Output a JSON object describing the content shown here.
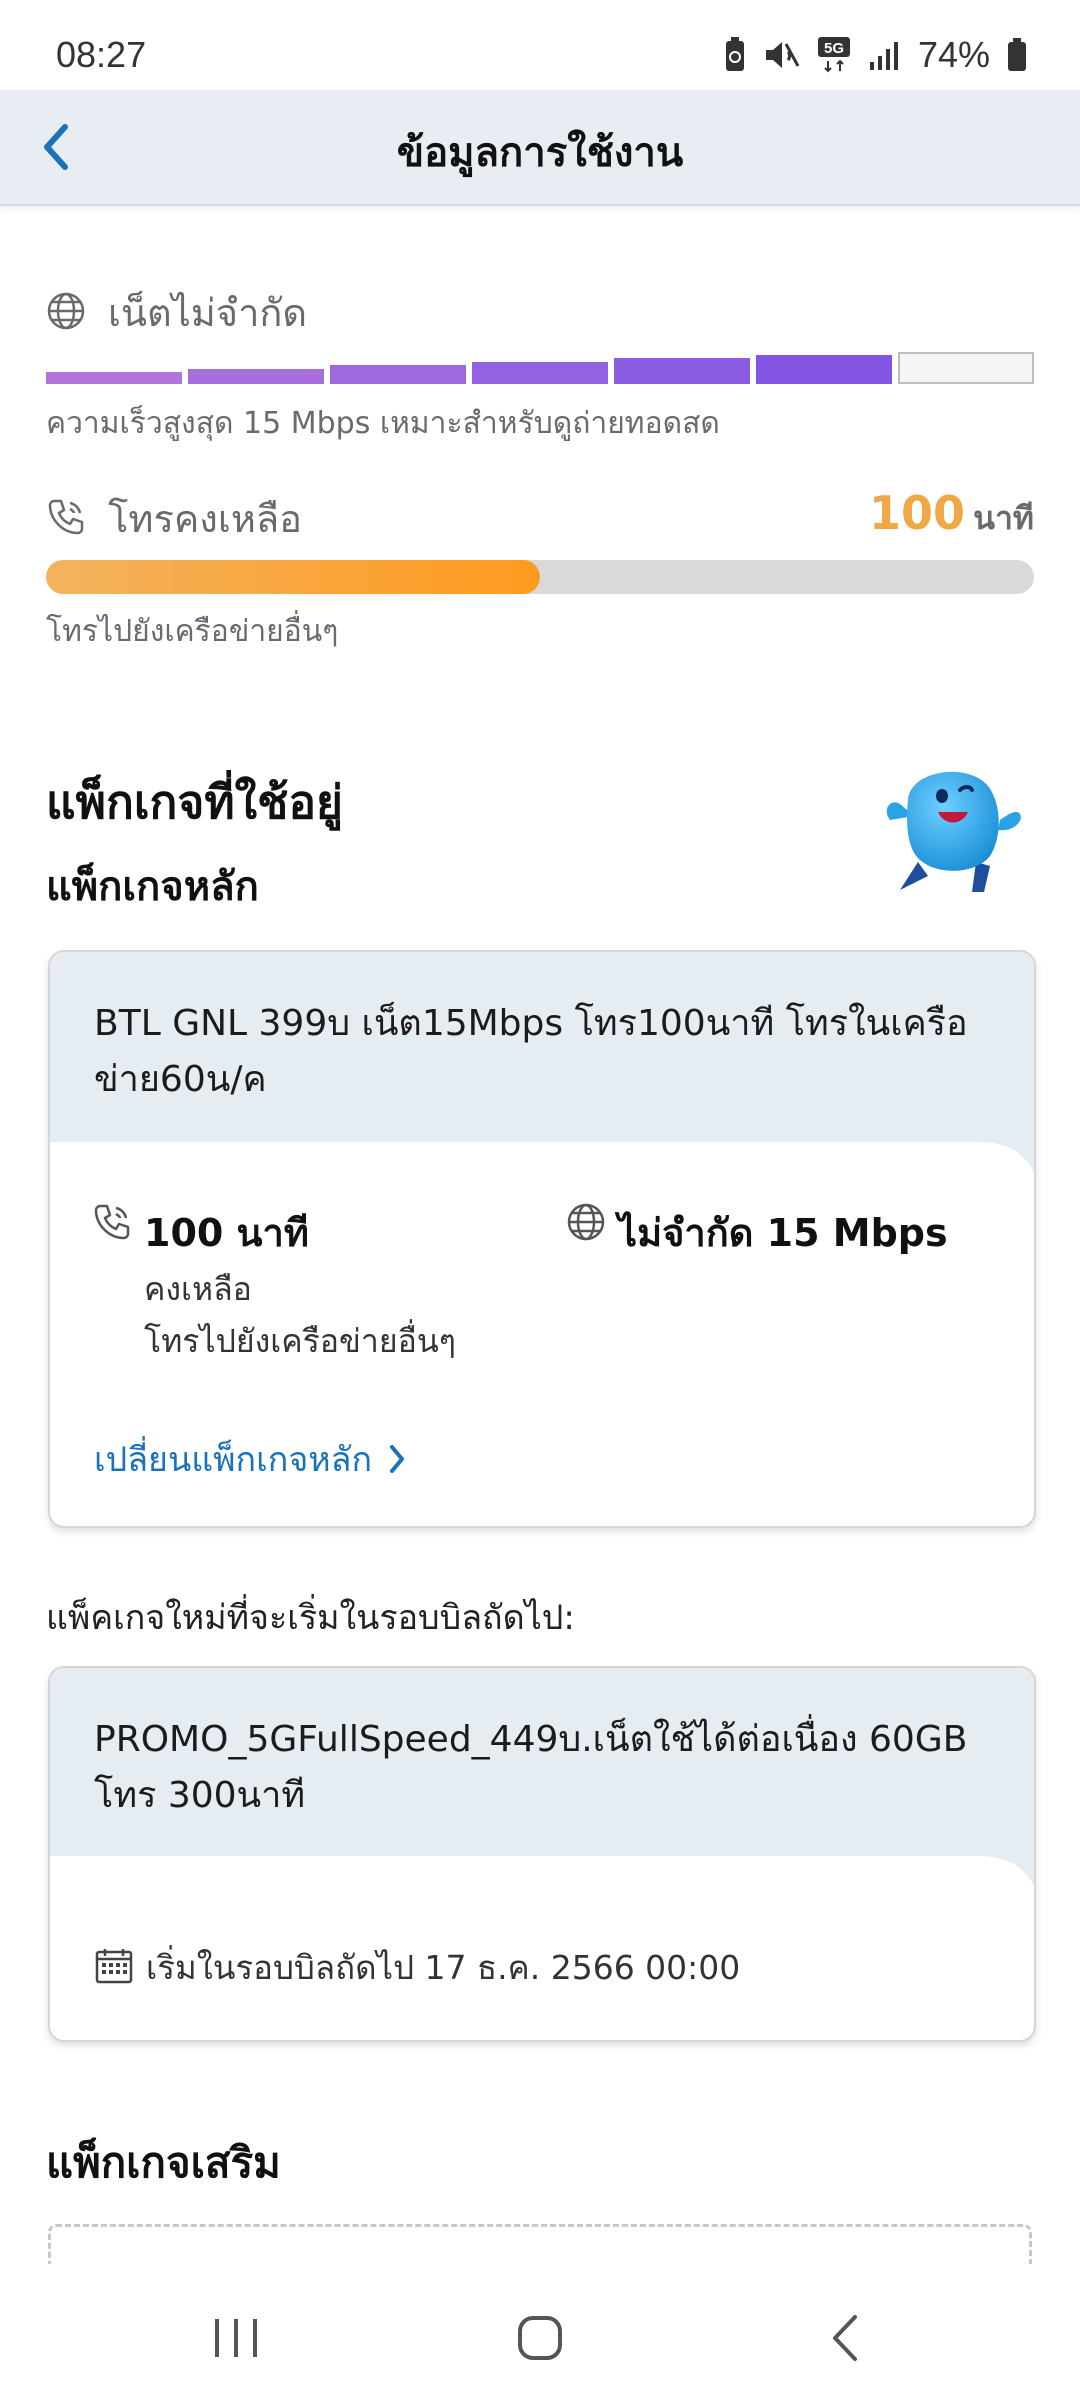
{
  "status_bar": {
    "time": "08:27",
    "network": "5G",
    "battery": "74%"
  },
  "header": {
    "title": "ข้อมูลการใช้งาน"
  },
  "internet": {
    "label": "เน็ตไม่จำกัด",
    "description": "ความเร็วสูงสุด 15 Mbps เหมาะสำหรับดูถ่ายทอดสด",
    "active_level": 6,
    "total_levels": 7,
    "bar_color": "#a46ddc"
  },
  "calls": {
    "label": "โทรคงเหลือ",
    "value": "100",
    "unit": "นาที",
    "description": "โทรไปยังเครือข่ายอื่นๆ",
    "remaining_fraction": 0.5,
    "accent_color": "#ff9a1f"
  },
  "current_package": {
    "section_title": "แพ็กเกจที่ใช้อยู่",
    "main_title": "แพ็กเกจหลัก",
    "name_line1": "BTL GNL 399บ เน็ต15Mbps โทร100นาที โทรในเครือ",
    "name_line2": "ข่าย60น/ค",
    "call_amount": "100 นาที",
    "call_line1": "คงเหลือ",
    "call_line2": "โทรไปยังเครือข่ายอื่นๆ",
    "data_amount": "ไม่จำกัด 15 Mbps",
    "change_link": "เปลี่ยนแพ็กเกจหลัก"
  },
  "next_package": {
    "label": "แพ็คเกจใหม่ที่จะเริ่มในรอบบิลถัดไป:",
    "name_line1": "PROMO_5GFullSpeed_449บ.เน็ตใช้ได้ต่อเนื่อง 60GB",
    "name_line2": "โทร 300นาที",
    "start_text": "เริ่มในรอบบิลถัดไป 17 ธ.ค. 2566 00:00"
  },
  "addon": {
    "title": "แพ็กเกจเสริม"
  },
  "colors": {
    "link": "#1a73b8",
    "header_bg": "#e7edf3"
  }
}
